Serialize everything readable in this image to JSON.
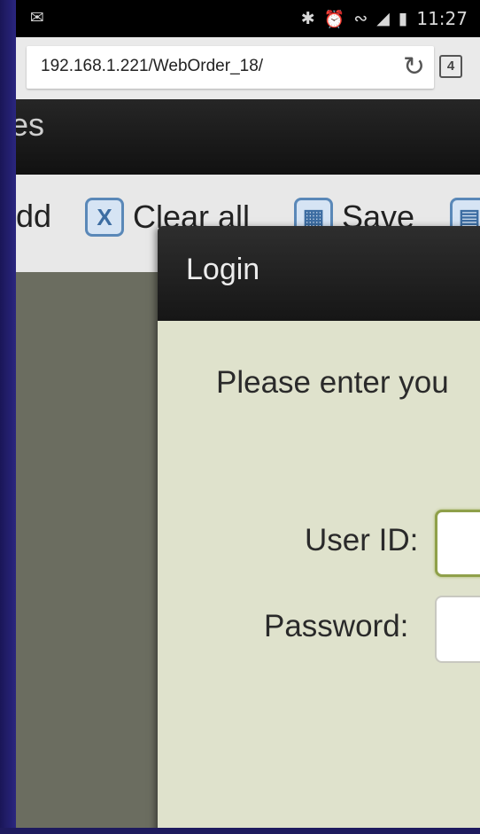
{
  "status_bar": {
    "time": "11:27",
    "icons": [
      "mail-icon",
      "bluetooth-icon",
      "alarm-icon",
      "wifi-icon",
      "signal-icon",
      "battery-icon"
    ]
  },
  "browser": {
    "url": "192.168.1.221/WebOrder_18/",
    "tab_count": "4"
  },
  "app": {
    "header_title": "es"
  },
  "toolbar": {
    "add_label": "dd",
    "clear_all_label": "Clear all",
    "save_label": "Save"
  },
  "login_dialog": {
    "title": "Login",
    "prompt": "Please enter you",
    "user_id_label": "User ID:",
    "password_label": "Password:"
  },
  "colors": {
    "accent_icon_blue": "#5a88b8",
    "dialog_body": "#dfe2cc",
    "input_focus_border": "#8fa04a"
  }
}
